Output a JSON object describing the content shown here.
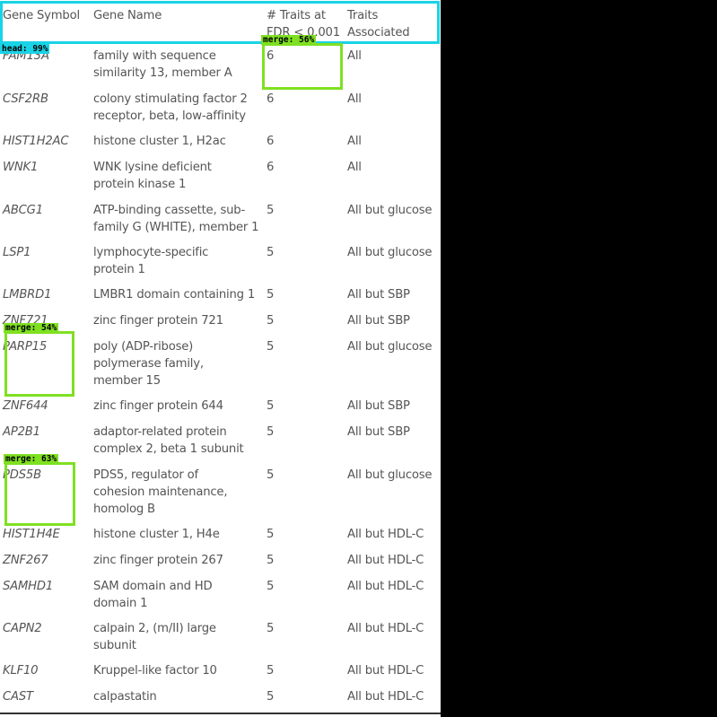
{
  "table": {
    "headers": {
      "symbol": "Gene Symbol",
      "name": "Gene Name",
      "traits": "# Traits at\nFDR < 0.001",
      "associated": "Traits\nAssociated"
    },
    "rows": [
      {
        "symbol": "FAM13A",
        "name": "family with sequence\nsimilarity 13, member A",
        "traits": "6",
        "associated": "All"
      },
      {
        "symbol": "CSF2RB",
        "name": "colony stimulating factor 2\nreceptor, beta, low-affinity",
        "traits": "6",
        "associated": "All"
      },
      {
        "symbol": "HIST1H2AC",
        "name": "histone cluster 1, H2ac",
        "traits": "6",
        "associated": "All"
      },
      {
        "symbol": "WNK1",
        "name": "WNK lysine deficient\nprotein kinase 1",
        "traits": "6",
        "associated": "All"
      },
      {
        "symbol": "ABCG1",
        "name": "ATP-binding cassette, sub-\nfamily G (WHITE), member 1",
        "traits": "5",
        "associated": "All but glucose"
      },
      {
        "symbol": "LSP1",
        "name": "lymphocyte-specific\nprotein 1",
        "traits": "5",
        "associated": "All but glucose"
      },
      {
        "symbol": "LMBRD1",
        "name": "LMBR1 domain containing 1",
        "traits": "5",
        "associated": "All but SBP"
      },
      {
        "symbol": "ZNF721",
        "name": "zinc finger protein 721",
        "traits": "5",
        "associated": "All but SBP"
      },
      {
        "symbol": "PARP15",
        "name": "poly (ADP-ribose)\npolymerase family,\nmember 15",
        "traits": "5",
        "associated": "All but glucose"
      },
      {
        "symbol": "ZNF644",
        "name": "zinc finger protein 644",
        "traits": "5",
        "associated": "All but SBP"
      },
      {
        "symbol": "AP2B1",
        "name": "adaptor-related protein\ncomplex 2, beta 1 subunit",
        "traits": "5",
        "associated": "All but SBP"
      },
      {
        "symbol": "PDS5B",
        "name": "PDS5, regulator of\ncohesion maintenance,\nhomolog B",
        "traits": "5",
        "associated": "All but glucose"
      },
      {
        "symbol": "HIST1H4E",
        "name": "histone cluster 1, H4e",
        "traits": "5",
        "associated": "All but HDL-C"
      },
      {
        "symbol": "ZNF267",
        "name": "zinc finger protein 267",
        "traits": "5",
        "associated": "All but HDL-C"
      },
      {
        "symbol": "SAMHD1",
        "name": "SAM domain and HD\ndomain 1",
        "traits": "5",
        "associated": "All but HDL-C"
      },
      {
        "symbol": "CAPN2",
        "name": "calpain 2, (m/II) large\nsubunit",
        "traits": "5",
        "associated": "All but HDL-C"
      },
      {
        "symbol": "KLF10",
        "name": "Kruppel-like factor 10",
        "traits": "5",
        "associated": "All but HDL-C"
      },
      {
        "symbol": "CAST",
        "name": "calpastatin",
        "traits": "5",
        "associated": "All but HDL-C"
      }
    ]
  },
  "overlays": [
    {
      "id": "head",
      "label": "head: 99%",
      "color": "#19d3e6"
    },
    {
      "id": "merge-traits",
      "label": "merge: 56%",
      "color": "#7fe022"
    },
    {
      "id": "merge-parp",
      "label": "merge: 54%",
      "color": "#7fe022"
    },
    {
      "id": "merge-pds",
      "label": "merge: 63%",
      "color": "#7fe022"
    }
  ]
}
